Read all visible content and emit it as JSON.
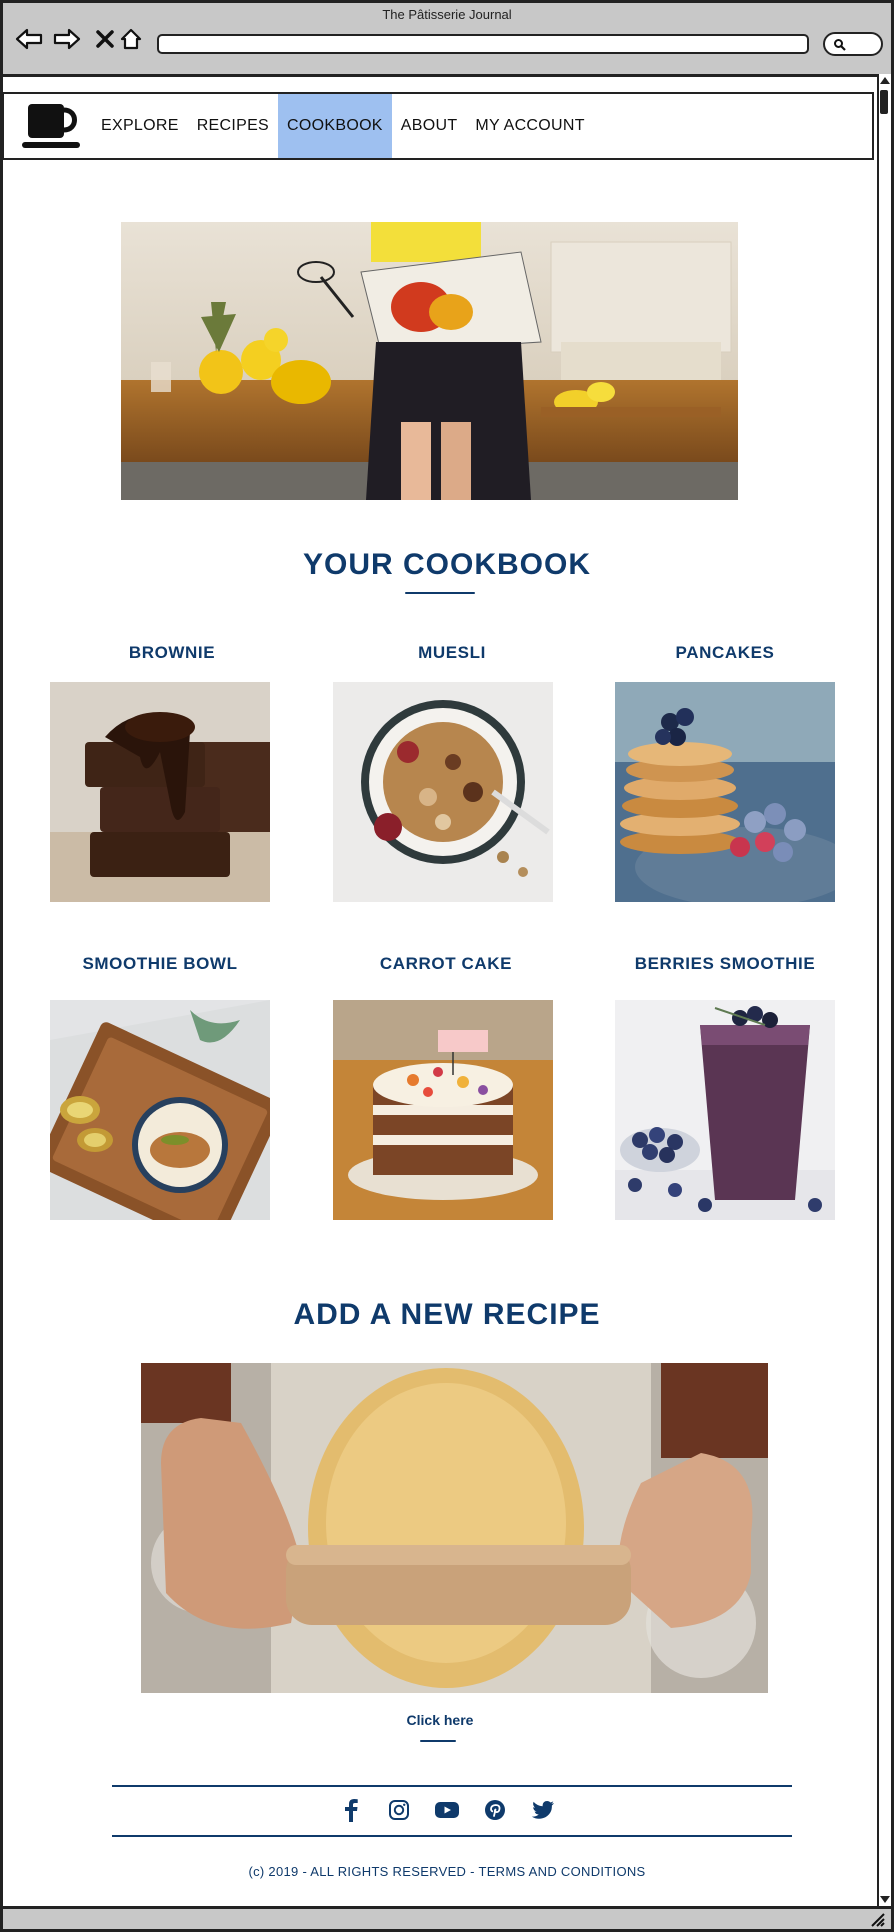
{
  "window": {
    "title": "The Pâtisserie Journal"
  },
  "nav": {
    "items": [
      {
        "label": "EXPLORE",
        "active": false
      },
      {
        "label": "RECIPES",
        "active": false
      },
      {
        "label": "COOKBOOK",
        "active": true
      },
      {
        "label": "ABOUT",
        "active": false
      },
      {
        "label": "MY ACCOUNT",
        "active": false
      }
    ]
  },
  "cookbook": {
    "heading": "YOUR COOKBOOK",
    "recipes": [
      {
        "title": "BROWNIE"
      },
      {
        "title": "MUESLI"
      },
      {
        "title": "PANCAKES"
      },
      {
        "title": "SMOOTHIE BOWL"
      },
      {
        "title": "CARROT CAKE"
      },
      {
        "title": "BERRIES SMOOTHIE"
      }
    ]
  },
  "add_recipe": {
    "heading": "ADD A NEW RECIPE",
    "link_label": "Click here"
  },
  "social_icons": [
    "facebook-icon",
    "instagram-icon",
    "youtube-icon",
    "pinterest-icon",
    "twitter-icon"
  ],
  "footer": {
    "text": "(c) 2019 - ALL RIGHTS RESERVED - TERMS AND CONDITIONS"
  },
  "colors": {
    "brand": "#0f3a6b",
    "nav_active": "#9ec0f0",
    "chrome": "#c8c8c8"
  }
}
